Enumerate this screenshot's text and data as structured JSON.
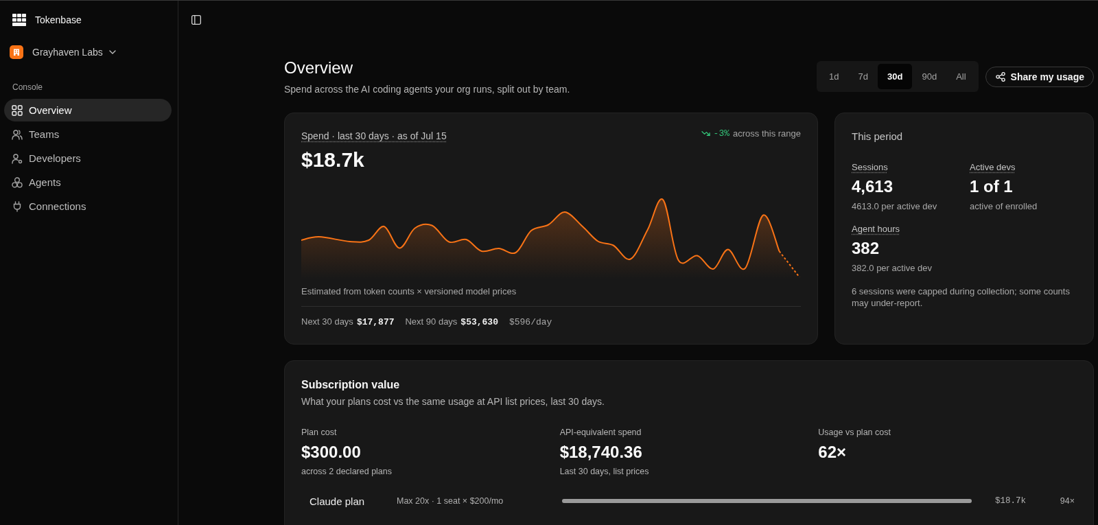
{
  "sidebar": {
    "brand": "Tokenbase",
    "org": {
      "name": "Grayhaven Labs"
    },
    "section": "Console",
    "items": [
      {
        "label": "Overview",
        "selected": true
      },
      {
        "label": "Teams",
        "selected": false
      },
      {
        "label": "Developers",
        "selected": false
      },
      {
        "label": "Agents",
        "selected": false
      },
      {
        "label": "Connections",
        "selected": false
      }
    ]
  },
  "header": {
    "title": "Overview",
    "subtitle": "Spend across the AI coding agents your org runs, split out by team.",
    "ranges": [
      {
        "label": "1d",
        "selected": false
      },
      {
        "label": "7d",
        "selected": false
      },
      {
        "label": "30d",
        "selected": true
      },
      {
        "label": "90d",
        "selected": false
      },
      {
        "label": "All",
        "selected": false
      }
    ],
    "share_button": "Share my usage"
  },
  "spend": {
    "title": "Spend · last 30 days · as of Jul 15",
    "total": "$18.7k",
    "trend": {
      "falling": true,
      "change": "-3%",
      "label": "across this range"
    },
    "caption": "Estimated from token counts × versioned model prices",
    "forecasts": [
      {
        "label": "Next 30 days",
        "value": "$17,877"
      },
      {
        "label": "Next 90 days",
        "value": "$53,630"
      }
    ],
    "daily_rate": "$596/day"
  },
  "period": {
    "title": "This period",
    "stats": [
      {
        "label": "Sessions",
        "value": "4,613",
        "detail": "4613.0 per active dev"
      },
      {
        "label": "Active devs",
        "value": "1 of 1",
        "detail": "active of enrolled"
      },
      {
        "label": "Agent hours",
        "value": "382",
        "detail": "382.0 per active dev"
      }
    ],
    "note": "6 sessions were capped during collection; some counts may under-report."
  },
  "subscription": {
    "title": "Subscription value",
    "subtitle": "What your plans cost vs the same usage at API list prices, last 30 days.",
    "metrics": [
      {
        "label": "Plan cost",
        "value": "$300.00",
        "detail": "across 2 declared plans"
      },
      {
        "label": "API-equivalent spend",
        "value": "$18,740.36",
        "detail": "Last 30 days, list prices"
      },
      {
        "label": "Usage vs plan cost",
        "value": "62×"
      }
    ],
    "plans": [
      {
        "name": "Claude plan",
        "terms": "Max 20x · 1 seat × $200/mo",
        "level": 1,
        "spend": "$18.7k",
        "multiple": "94×"
      }
    ]
  }
}
